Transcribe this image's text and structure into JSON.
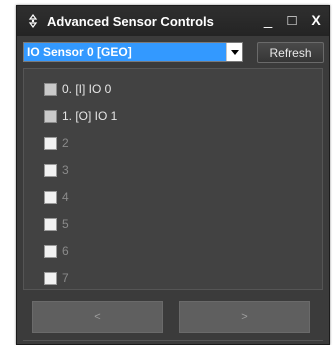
{
  "window": {
    "title": "Advanced Sensor Controls",
    "minimize_glyph": "_",
    "maximize_glyph": "□",
    "close_glyph": "X",
    "app_icon": "compass-icon"
  },
  "toolbar": {
    "sensor_select_value": "IO Sensor 0 [GEO]",
    "refresh_label": "Refresh"
  },
  "sensors": [
    {
      "label": "0. [I] IO 0",
      "enabled": true
    },
    {
      "label": "1. [O] IO 1",
      "enabled": true
    },
    {
      "label": "2",
      "enabled": false
    },
    {
      "label": "3",
      "enabled": false
    },
    {
      "label": "4",
      "enabled": false
    },
    {
      "label": "5",
      "enabled": false
    },
    {
      "label": "6",
      "enabled": false
    },
    {
      "label": "7",
      "enabled": false
    }
  ],
  "nav": {
    "prev_label": "<",
    "next_label": ">"
  },
  "colors": {
    "selection": "#3399ff",
    "window_bg": "#3b3b3b"
  }
}
